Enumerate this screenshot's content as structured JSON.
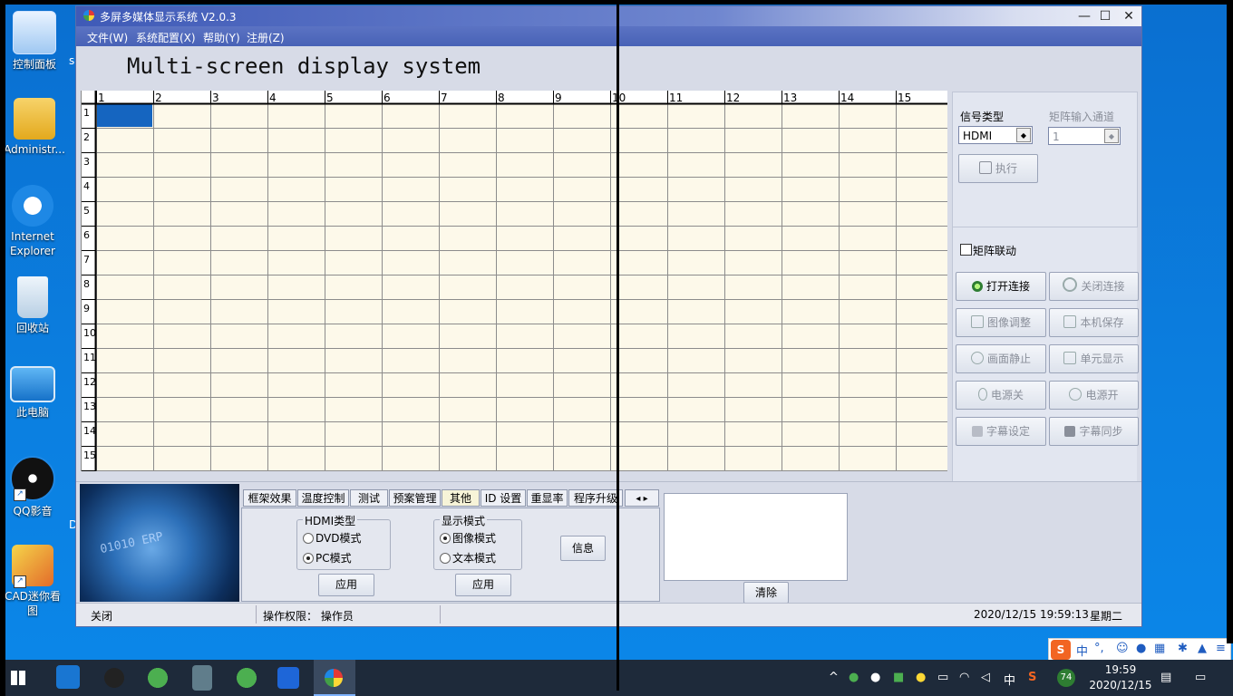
{
  "desktop": {
    "icons": [
      {
        "name": "control-panel",
        "label": "控制面板"
      },
      {
        "name": "administrator",
        "label": "Administr..."
      },
      {
        "name": "internet-explorer",
        "label": "Internet\nExplorer"
      },
      {
        "name": "recycle-bin",
        "label": "回收站"
      },
      {
        "name": "this-pc",
        "label": "此电脑"
      },
      {
        "name": "qq-player",
        "label": "QQ影音"
      },
      {
        "name": "cad-viewer",
        "label": "CAD迷你看\n图"
      }
    ],
    "stray_s": "s",
    "stray_d": "D"
  },
  "window": {
    "title": "多屏多媒体显示系统 V2.0.3",
    "menu": [
      "文件(W)",
      "系统配置(X)",
      "帮助(Y)",
      "注册(Z)"
    ],
    "headline": "Multi-screen display system",
    "controls": {
      "minimize": "—",
      "maximize": "☐",
      "close": "✕"
    }
  },
  "grid": {
    "columns": [
      "1",
      "2",
      "3",
      "4",
      "5",
      "6",
      "7",
      "8",
      "9",
      "10",
      "11",
      "12",
      "13",
      "14",
      "15"
    ],
    "rows": [
      "1",
      "2",
      "3",
      "4",
      "5",
      "6",
      "7",
      "8",
      "9",
      "10",
      "11",
      "12",
      "13",
      "14",
      "15"
    ],
    "selected_cell": {
      "row": 1,
      "col": 1
    },
    "colors": {
      "cell": "#fdf9ea",
      "line": "#8c8c8c",
      "selected": "#1565c0"
    }
  },
  "right_panel": {
    "signal_type_label": "信号类型",
    "signal_type_value": "HDMI",
    "matrix_channel_label": "矩阵输入通道",
    "matrix_channel_value": "1",
    "execute_label": "执行",
    "matrix_link_label": "矩阵联动",
    "buttons": [
      {
        "label": "打开连接",
        "enabled": true
      },
      {
        "label": "关闭连接",
        "enabled": false
      },
      {
        "label": "图像调整",
        "enabled": false
      },
      {
        "label": "本机保存",
        "enabled": false
      },
      {
        "label": "画面静止",
        "enabled": false
      },
      {
        "label": "单元显示",
        "enabled": false
      },
      {
        "label": "电源关",
        "enabled": false
      },
      {
        "label": "电源开",
        "enabled": false
      },
      {
        "label": "字幕设定",
        "enabled": false
      },
      {
        "label": "字幕同步",
        "enabled": false
      }
    ]
  },
  "tabs": [
    "框架效果",
    "温度控制",
    "测试",
    "预案管理",
    "其他",
    "ID 设置",
    "重显率",
    "程序升级"
  ],
  "tab_scroll": "◂ ▸",
  "other_tab": {
    "hdmi_type_title": "HDMI类型",
    "hdmi_options": [
      "DVD模式",
      "PC模式"
    ],
    "hdmi_selected": "PC模式",
    "display_mode_title": "显示模式",
    "display_options": [
      "图像模式",
      "文本模式"
    ],
    "display_selected": "图像模式",
    "apply_label": "应用",
    "info_label": "信息"
  },
  "clear_label": "清除",
  "banner_text": "01010  ERP",
  "status": {
    "left": "关闭",
    "permission": "操作权限：  操作员",
    "datetime": "2020/12/15 19:59:13",
    "weekday": "星期二"
  },
  "ime": {
    "brand": "S",
    "mode": "中",
    "punct": "°,"
  },
  "taskbar": {
    "tray_input": "中",
    "battery_badge": "74",
    "time": "19:59",
    "date": "2020/12/15"
  }
}
